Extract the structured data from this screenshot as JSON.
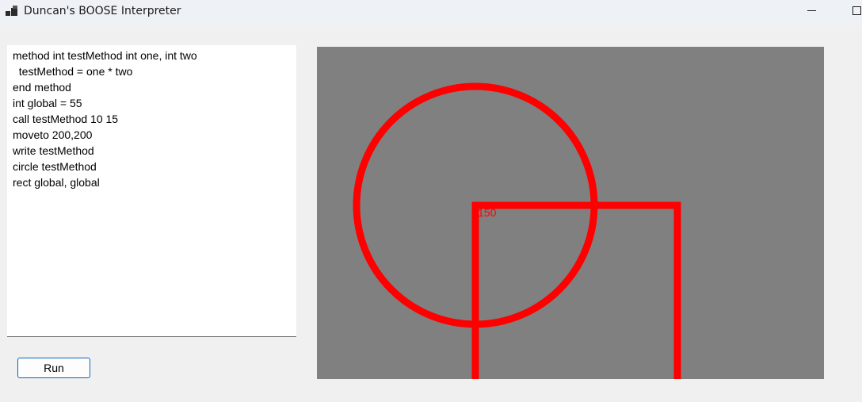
{
  "window": {
    "title": "Duncan's BOOSE Interpreter",
    "icon": "app-icon"
  },
  "editor": {
    "lines": [
      "method int testMethod int one, int two",
      "  testMethod = one * two",
      "end method",
      "int global = 55",
      "call testMethod 10 15",
      "moveto 200,200",
      "write testMethod",
      "circle testMethod",
      "rect global, global"
    ]
  },
  "run_button": {
    "label": "Run"
  },
  "canvas": {
    "background": "#808080",
    "pen_color": "#ff0000",
    "text_output": "150"
  }
}
